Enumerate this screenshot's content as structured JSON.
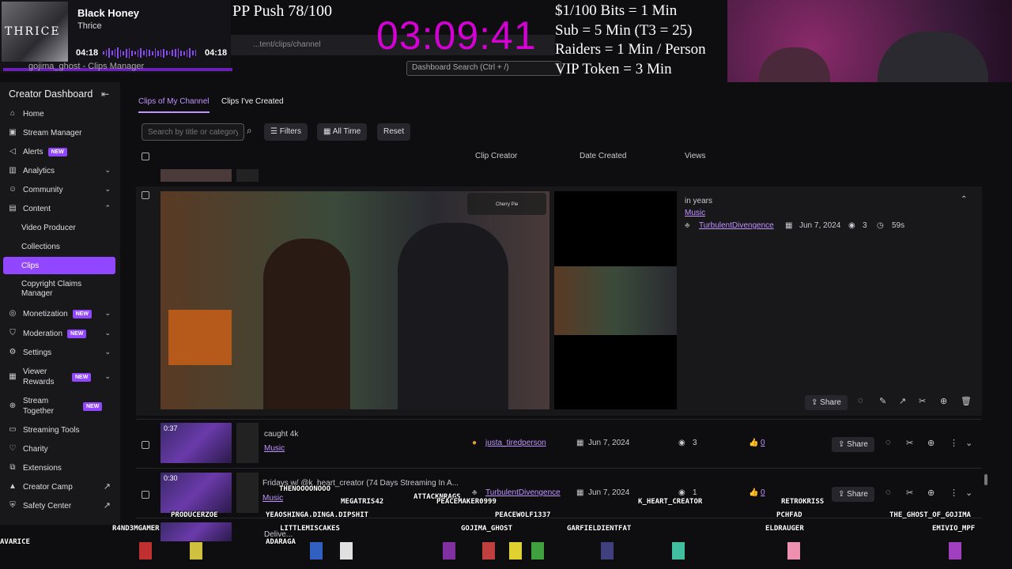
{
  "now_playing": {
    "song": "Black Honey",
    "artist": "Thrice",
    "album_text": "THRICE",
    "time_elapsed": "04:18",
    "time_total": "04:18"
  },
  "overlay": {
    "pp_push": "PP Push 78/100",
    "timer": "03:09:41",
    "rules": [
      "$1/100 Bits = 1 Min",
      "Sub = 5 Min (T3 = 25)",
      "Raiders = 1 Min / Person",
      "VIP Token = 3 Min"
    ]
  },
  "browser": {
    "url": "...tent/clips/channel",
    "tab_title": "gojima_ghost - Clips Manager",
    "dashboard_search": "Dashboard Search (Ctrl + /)"
  },
  "sidebar": {
    "title": "Creator Dashboard",
    "items": [
      {
        "label": "Home",
        "icon": "home-icon"
      },
      {
        "label": "Stream Manager",
        "icon": "stream-manager-icon"
      },
      {
        "label": "Alerts",
        "icon": "alerts-icon",
        "badge": "NEW"
      },
      {
        "label": "Analytics",
        "icon": "analytics-icon"
      },
      {
        "label": "Community",
        "icon": "community-icon"
      },
      {
        "label": "Content",
        "icon": "content-icon"
      },
      {
        "label": "Video Producer"
      },
      {
        "label": "Collections"
      },
      {
        "label": "Clips"
      },
      {
        "label": "Copyright Claims Manager"
      },
      {
        "label": "Monetization",
        "icon": "monetization-icon",
        "badge": "NEW"
      },
      {
        "label": "Moderation",
        "icon": "moderation-icon",
        "badge": "NEW"
      },
      {
        "label": "Settings",
        "icon": "settings-icon"
      },
      {
        "label": "Viewer Rewards",
        "icon": "viewer-rewards-icon",
        "badge": "NEW"
      },
      {
        "label": "Stream Together",
        "icon": "stream-together-icon",
        "badge": "NEW"
      },
      {
        "label": "Streaming Tools",
        "icon": "streaming-tools-icon"
      },
      {
        "label": "Charity",
        "icon": "charity-icon"
      },
      {
        "label": "Extensions",
        "icon": "extensions-icon"
      },
      {
        "label": "Creator Camp",
        "icon": "creator-camp-icon"
      },
      {
        "label": "Safety Center",
        "icon": "safety-center-icon"
      }
    ]
  },
  "tabs": [
    "Clips of My Channel",
    "Clips I've Created"
  ],
  "filters": {
    "search_placeholder": "Search by title or category",
    "filters_label": "Filters",
    "time_label": "All Time",
    "reset_label": "Reset"
  },
  "columns": [
    "Clip Creator",
    "Date Created",
    "Views"
  ],
  "expanded_clip": {
    "title": "in years",
    "category": "Music",
    "creator": "TurbulentDivengence",
    "date": "Jun 7, 2024",
    "views": "3",
    "duration": "59s",
    "share_label": "Share",
    "preview_label": "Cherry Pie"
  },
  "rows": [
    {
      "duration": "0:37",
      "title": "caught 4k",
      "category": "Music",
      "creator": "justa_tiredperson",
      "date": "Jun 7, 2024",
      "views": "3",
      "likes": "0",
      "share": "Share"
    },
    {
      "duration": "0:30",
      "title": "Fridays w/ @k_heart_creator (74 Days Streaming In A...",
      "category": "Music",
      "creator": "TurbulentDivengence",
      "date": "Jun 7, 2024",
      "views": "1",
      "likes": "0",
      "share": "Share"
    },
    {
      "duration": "",
      "title": "Delive...",
      "category": "",
      "creator": "",
      "date": "",
      "views": "",
      "likes": "",
      "share": ""
    }
  ],
  "chatters": [
    "THENOOOONOOO",
    "MEGATRIS42",
    "ATTACKNRAGS",
    "PEACEMAKER0999",
    "K_HEART_CREATOR",
    "RETROKRISS",
    "PRODUCERZOE",
    "YEAOSHINGA.DINGA.DIPSHIT",
    "PEACEWOLF1337",
    "PCHFAD",
    "THE_GHOST_OF_GOJIMA",
    "R4ND3MGAMER",
    "LITTLEMISCAKES",
    "GOJIMA_GHOST",
    "GARFIELDIENTFAT",
    "ELDRAUGER",
    "EMIVIO_MPF",
    "AVARICE",
    "ADARAGA"
  ],
  "colors": {
    "accent": "#9147ff",
    "timer": "#d400d4",
    "link": "#bf94ff"
  }
}
